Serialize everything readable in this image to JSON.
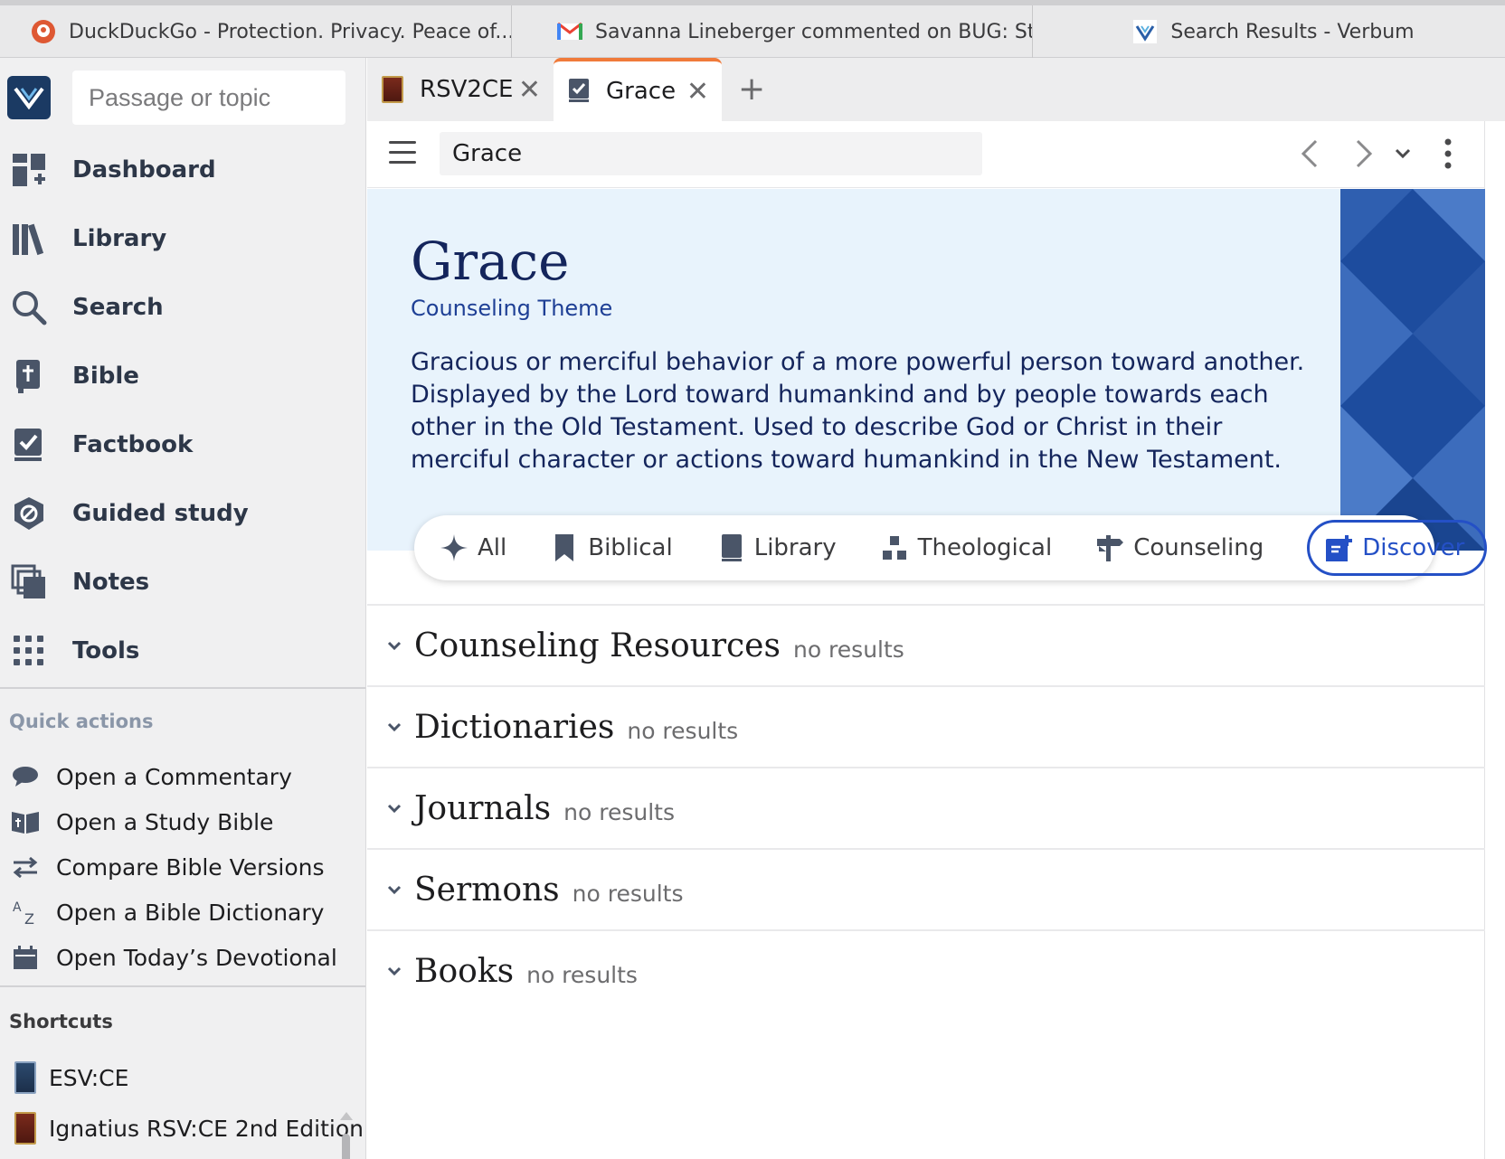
{
  "browser_tabs": [
    {
      "title": "DuckDuckGo - Protection. Privacy. Peace of..."
    },
    {
      "title": "Savanna Lineberger commented on BUG: St..."
    },
    {
      "title": "Search Results - Verbum"
    }
  ],
  "sidebar": {
    "search_placeholder": "Passage or topic",
    "nav": [
      {
        "label": "Dashboard",
        "icon": "dashboard-icon"
      },
      {
        "label": "Library",
        "icon": "library-icon"
      },
      {
        "label": "Search",
        "icon": "search-icon"
      },
      {
        "label": "Bible",
        "icon": "bible-icon"
      },
      {
        "label": "Factbook",
        "icon": "factbook-icon"
      },
      {
        "label": "Guided study",
        "icon": "guided-study-icon"
      },
      {
        "label": "Notes",
        "icon": "notes-icon"
      },
      {
        "label": "Tools",
        "icon": "tools-icon"
      }
    ],
    "quick_actions_title": "Quick actions",
    "quick_actions": [
      {
        "label": "Open a Commentary",
        "icon": "commentary-icon"
      },
      {
        "label": "Open a Study Bible",
        "icon": "study-bible-icon"
      },
      {
        "label": "Compare Bible Versions",
        "icon": "compare-icon"
      },
      {
        "label": "Open a Bible Dictionary",
        "icon": "dictionary-icon"
      },
      {
        "label": "Open Today’s Devotional",
        "icon": "calendar-icon"
      }
    ],
    "shortcuts_title": "Shortcuts",
    "shortcuts": [
      {
        "label": "ESV:CE"
      },
      {
        "label": "Ignatius RSV:CE 2nd Edition"
      }
    ]
  },
  "app_tabs": [
    {
      "label": "RSV2CE"
    },
    {
      "label": "Grace"
    }
  ],
  "toolbar": {
    "title_value": "Grace"
  },
  "hero": {
    "title": "Grace",
    "subtitle": "Counseling Theme",
    "description": "Gracious or merciful behavior of a more powerful person toward another. Displayed by the Lord toward humankind and by people towards each other in the Old Testament. Used to describe God or Christ in their merciful character or actions toward humankind in the New Testament."
  },
  "filters": [
    {
      "label": "All",
      "icon": "sparkle-icon"
    },
    {
      "label": "Biblical",
      "icon": "bookmark-icon"
    },
    {
      "label": "Library",
      "icon": "book-icon"
    },
    {
      "label": "Theological",
      "icon": "hierarchy-icon"
    },
    {
      "label": "Counseling",
      "icon": "signpost-icon"
    },
    {
      "label": "Discover",
      "icon": "discover-icon",
      "active": true
    }
  ],
  "results": [
    {
      "name": "Counseling Resources",
      "count": "no results"
    },
    {
      "name": "Dictionaries",
      "count": "no results"
    },
    {
      "name": "Journals",
      "count": "no results"
    },
    {
      "name": "Sermons",
      "count": "no results"
    },
    {
      "name": "Books",
      "count": "no results"
    }
  ],
  "colors": {
    "accent": "#2450c6",
    "tab_highlight": "#f07a3a",
    "hero_bg": "#e8f3fc",
    "hero_text": "#14255c",
    "quick_actions_title": "#8a96a8",
    "shortcuts_title": "#3a3a3c"
  }
}
